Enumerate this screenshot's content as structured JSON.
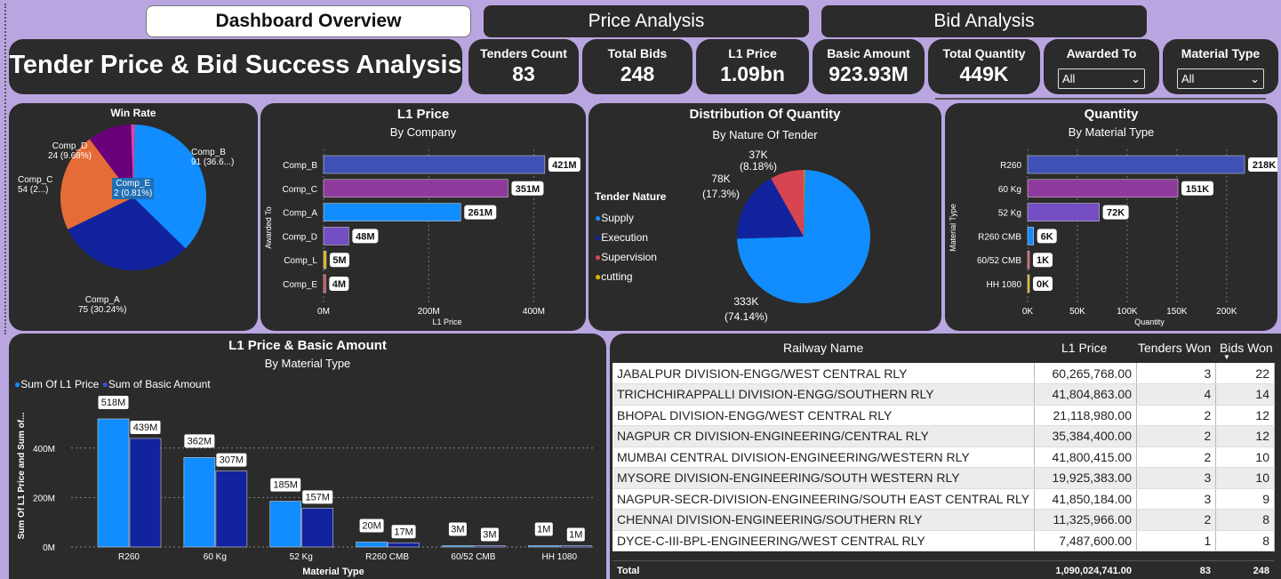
{
  "tabs": [
    "Dashboard Overview",
    "Price Analysis",
    "Bid Analysis"
  ],
  "report_title": "Tender Price & Bid Success Analysis",
  "kpis": [
    {
      "label": "Tenders Count",
      "value": "83"
    },
    {
      "label": "Total Bids",
      "value": "248"
    },
    {
      "label": "L1 Price",
      "value": "1.09bn"
    },
    {
      "label": "Basic Amount",
      "value": "923.93M"
    },
    {
      "label": "Total Quantity",
      "value": "449K"
    }
  ],
  "slicers": [
    {
      "label": "Awarded To",
      "value": "All"
    },
    {
      "label": "Material Type",
      "value": "All"
    }
  ],
  "win_rate": {
    "title": "Win Rate",
    "labels": [
      "Comp_B",
      "91 (36.6...)",
      "Comp_A",
      "75 (30.24%)",
      "Comp_C",
      "54 (2...)",
      "Comp_D",
      "24 (9.68%)",
      "Comp_E",
      "2 (0.81%)"
    ]
  },
  "l1_by_company": {
    "title": "L1 Price",
    "subtitle": "By Company",
    "xlabel": "L1 Price",
    "ylabel": "Awarded To",
    "ticks": [
      "0M",
      "200M",
      "400M"
    ]
  },
  "qty_by_nature": {
    "title": "Distribution Of Quantity",
    "subtitle": "By Nature Of Tender",
    "legend_title": "Tender Nature",
    "legend": [
      "Supply",
      "Execution",
      "Supervision",
      "cutting"
    ],
    "labels": [
      "37K",
      "(8.18%)",
      "78K",
      "(17.3%)",
      "333K",
      "(74.14%)"
    ]
  },
  "qty_by_material": {
    "title": "Quantity",
    "subtitle": "By Material Type",
    "xlabel": "Quantity",
    "ylabel": "Material Type",
    "ticks": [
      "0K",
      "50K",
      "100K",
      "150K",
      "200K"
    ]
  },
  "l1_basic": {
    "title": "L1 Price & Basic Amount",
    "subtitle": "By Material Type",
    "legend": [
      "Sum Of L1 Price",
      "Sum of Basic Amount"
    ],
    "xlabel": "Material Type",
    "ylabel": "Sum Of L1 Price and Sum of...",
    "ticks": [
      "0M",
      "200M",
      "400M"
    ]
  },
  "railway_table": {
    "headers": [
      "Railway Name",
      "L1 Price",
      "Tenders Won",
      "Bids Won"
    ],
    "rows": [
      [
        "JABALPUR DIVISION-ENGG/WEST CENTRAL RLY",
        "60,265,768.00",
        "3",
        "22"
      ],
      [
        "TRICHCHIRAPPALLI DIVISION-ENGG/SOUTHERN RLY",
        "41,804,863.00",
        "4",
        "14"
      ],
      [
        "BHOPAL DIVISION-ENGG/WEST CENTRAL RLY",
        "21,118,980.00",
        "2",
        "12"
      ],
      [
        "NAGPUR CR DIVISION-ENGINEERING/CENTRAL RLY",
        "35,384,400.00",
        "2",
        "12"
      ],
      [
        "MUMBAI CENTRAL DIVISION-ENGINEERING/WESTERN RLY",
        "41,800,415.00",
        "2",
        "10"
      ],
      [
        "MYSORE DIVISION-ENGINEERING/SOUTH WESTERN RLY",
        "19,925,383.00",
        "3",
        "10"
      ],
      [
        "NAGPUR-SECR-DIVISION-ENGINEERING/SOUTH EAST CENTRAL RLY",
        "41,850,184.00",
        "3",
        "9"
      ],
      [
        "CHENNAI DIVISION-ENGINEERING/SOUTHERN RLY",
        "11,325,966.00",
        "2",
        "8"
      ],
      [
        "DYCE-C-III-BPL-ENGINEERING/WEST CENTRAL RLY",
        "7,487,600.00",
        "1",
        "8"
      ]
    ],
    "total": [
      "Total",
      "1,090,024,741.00",
      "83",
      "248"
    ]
  },
  "chart_data": [
    {
      "type": "pie",
      "title": "Win Rate",
      "categories": [
        "Comp_B",
        "Comp_A",
        "Comp_C",
        "Comp_D",
        "Comp_E"
      ],
      "values": [
        91,
        75,
        54,
        24,
        2
      ],
      "colors": [
        "#118dff",
        "#12239e",
        "#e66c37",
        "#6b007b",
        "#e044a7"
      ]
    },
    {
      "type": "bar",
      "title": "L1 Price",
      "subtitle": "By Company",
      "categories": [
        "Comp_B",
        "Comp_C",
        "Comp_A",
        "Comp_D",
        "Comp_L",
        "Comp_E"
      ],
      "values": [
        421,
        351,
        261,
        48,
        5,
        4
      ],
      "labels": [
        "421M",
        "351M",
        "261M",
        "48M",
        "5M",
        "4M"
      ],
      "colors": [
        "#3f51b5",
        "#8e3a9d",
        "#118dff",
        "#744ec2",
        "#d9b300",
        "#d64550"
      ],
      "xlim": [
        0,
        450
      ],
      "xlabel": "L1 Price",
      "ylabel": "Awarded To"
    },
    {
      "type": "pie",
      "title": "Distribution Of Quantity",
      "subtitle": "By Nature Of Tender",
      "categories": [
        "Supply",
        "Execution",
        "Supervision",
        "cutting"
      ],
      "values": [
        333,
        78,
        37,
        1
      ],
      "colors": [
        "#118dff",
        "#12239e",
        "#d64550",
        "#d9b300"
      ]
    },
    {
      "type": "bar",
      "title": "Quantity",
      "subtitle": "By Material Type",
      "categories": [
        "R260",
        "60 Kg",
        "52 Kg",
        "R260 CMB",
        "60/52 CMB",
        "HH 1080"
      ],
      "values": [
        218,
        151,
        72,
        6,
        1,
        0
      ],
      "labels": [
        "218K",
        "151K",
        "72K",
        "6K",
        "1K",
        "0K"
      ],
      "colors": [
        "#3f51b5",
        "#8e3a9d",
        "#744ec2",
        "#118dff",
        "#d64550",
        "#d9b300"
      ],
      "xlim": [
        0,
        218
      ],
      "xlabel": "Quantity",
      "ylabel": "Material Type"
    },
    {
      "type": "bar",
      "title": "L1 Price & Basic Amount",
      "subtitle": "By Material Type",
      "categories": [
        "R260",
        "60 Kg",
        "52 Kg",
        "R260 CMB",
        "60/52 CMB",
        "HH 1080"
      ],
      "series": [
        {
          "name": "Sum Of L1 Price",
          "values": [
            518,
            362,
            185,
            20,
            3,
            1
          ],
          "labels": [
            "518M",
            "362M",
            "185M",
            "20M",
            "3M",
            "1M"
          ],
          "color": "#118dff"
        },
        {
          "name": "Sum of Basic Amount",
          "values": [
            439,
            307,
            157,
            17,
            3,
            1
          ],
          "labels": [
            "439M",
            "307M",
            "157M",
            "17M",
            "3M",
            "1M"
          ],
          "color": "#12239e"
        }
      ],
      "ylim": [
        0,
        518
      ],
      "xlabel": "Material Type",
      "ylabel": "Sum Of L1 Price and Sum of..."
    }
  ]
}
